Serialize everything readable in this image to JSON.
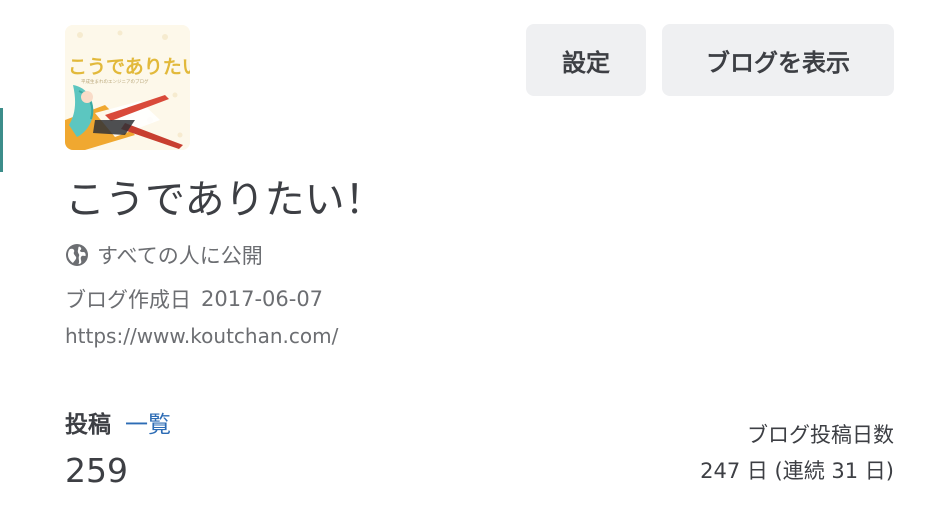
{
  "header": {
    "settings_label": "設定",
    "view_blog_label": "ブログを表示"
  },
  "blog": {
    "icon_text": "こうでありたい!",
    "icon_subtext": "平成生まれのエンジニアのブログ",
    "title": "こうでありたい！",
    "visibility": "すべての人に公開",
    "created_label": "ブログ作成日",
    "created_date": "2017-06-07",
    "url": "https://www.koutchan.com/"
  },
  "stats": {
    "posts_label": "投稿",
    "posts_link": "一覧",
    "posts_count": "259",
    "days_label": "ブログ投稿日数",
    "days_value": "247 日 (連続 31 日)"
  },
  "colors": {
    "button_bg": "#eff0f2",
    "text": "#3d3f44",
    "muted_text": "#6c6e72",
    "link": "#2d6cb5",
    "accent_bar": "#3c8d8a"
  }
}
